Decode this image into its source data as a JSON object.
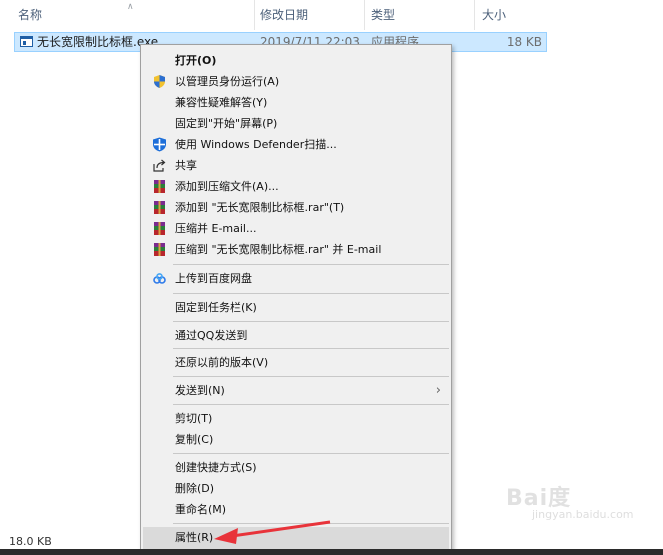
{
  "columns": {
    "name": "名称",
    "date": "修改日期",
    "type": "类型",
    "size": "大小"
  },
  "file": {
    "name": "无长宽限制比标框.exe",
    "date": "2019/7/11 22:03",
    "type": "应用程序",
    "size": "18 KB"
  },
  "status": {
    "size": "18.0 KB"
  },
  "menu": {
    "items": [
      {
        "label": "打开(O)",
        "icon": "none"
      },
      {
        "label": "以管理员身份运行(A)",
        "icon": "uac-shield-icon"
      },
      {
        "label": "兼容性疑难解答(Y)",
        "icon": "none"
      },
      {
        "label": "固定到\"开始\"屏幕(P)",
        "icon": "none"
      },
      {
        "label": "使用 Windows Defender扫描...",
        "icon": "defender-icon"
      },
      {
        "label": "共享",
        "icon": "share-icon"
      },
      {
        "label": "添加到压缩文件(A)...",
        "icon": "winrar-icon"
      },
      {
        "label": "添加到 \"无长宽限制比标框.rar\"(T)",
        "icon": "winrar-icon"
      },
      {
        "label": "压缩并 E-mail...",
        "icon": "winrar-icon"
      },
      {
        "label": "压缩到 \"无长宽限制比标框.rar\" 并 E-mail",
        "icon": "winrar-icon"
      },
      {
        "label": "上传到百度网盘",
        "icon": "baidu-netdisk-icon"
      },
      {
        "label": "固定到任务栏(K)",
        "icon": "none"
      },
      {
        "label": "通过QQ发送到",
        "icon": "none"
      },
      {
        "label": "还原以前的版本(V)",
        "icon": "none"
      },
      {
        "label": "发送到(N)",
        "icon": "none"
      },
      {
        "label": "剪切(T)",
        "icon": "none"
      },
      {
        "label": "复制(C)",
        "icon": "none"
      },
      {
        "label": "创建快捷方式(S)",
        "icon": "none"
      },
      {
        "label": "删除(D)",
        "icon": "none"
      },
      {
        "label": "重命名(M)",
        "icon": "none"
      },
      {
        "label": "属性(R)",
        "icon": "none"
      }
    ]
  },
  "annotation": {
    "arrow_color": "#e8333a"
  },
  "watermark": {
    "logo": "Bai度",
    "sub": "jingyan.baidu.com"
  }
}
